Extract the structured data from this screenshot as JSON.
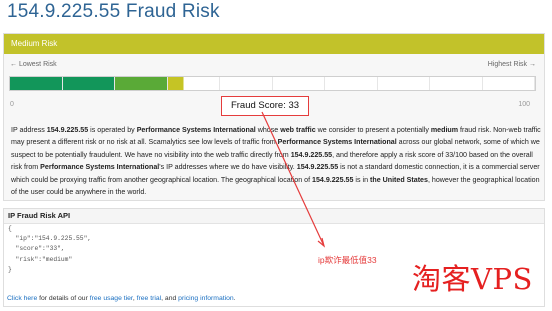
{
  "page": {
    "title": "154.9.225.55 Fraud Risk"
  },
  "risk_panel": {
    "header": "Medium Risk",
    "lowest_label": "← Lowest Risk",
    "highest_label": "Highest Risk →",
    "min": "0",
    "max": "100",
    "score_text": "Fraud Score: 33",
    "score": 33,
    "segment_colors": [
      "#12965a",
      "#12965a",
      "#5aaa37",
      "#94b52d",
      "#c5c425"
    ],
    "description": [
      {
        "t": "IP address "
      },
      {
        "t": "154.9.225.55",
        "b": true
      },
      {
        "t": " is operated by "
      },
      {
        "t": "Performance Systems International",
        "b": true
      },
      {
        "t": " whose "
      },
      {
        "t": "web traffic",
        "b": true
      },
      {
        "t": " we consider to present a potentially "
      },
      {
        "t": "medium",
        "b": true
      },
      {
        "t": " fraud risk. Non-web traffic may present a different risk or no risk at all. Scamalytics see low levels of traffic from "
      },
      {
        "t": "Performance Systems International",
        "b": true
      },
      {
        "t": " across our global network, some of which we suspect to be potentially fraudulent. We have no visibility into the web traffic directly from "
      },
      {
        "t": "154.9.225.55",
        "b": true
      },
      {
        "t": ", and therefore apply a risk score of 33/100 based on the overall risk from "
      },
      {
        "t": "Performance Systems International",
        "b": true
      },
      {
        "t": "'s IP addresses where we do have visibility. "
      },
      {
        "t": "154.9.225.55",
        "b": true
      },
      {
        "t": " is not a standard domestic connection, it is a commercial server which could be proxying traffic from another geographical location. The geographical location of "
      },
      {
        "t": "154.9.225.55",
        "b": true
      },
      {
        "t": " is in "
      },
      {
        "t": "the United States",
        "b": true
      },
      {
        "t": ", however the geographical location of the user could be anywhere in the world."
      }
    ]
  },
  "api": {
    "title": "IP Fraud Risk API",
    "code_lines": [
      "{",
      "  \"ip\":\"154.9.225.55\",",
      "  \"score\":\"33\",",
      "  \"risk\":\"medium\"",
      "}"
    ],
    "links": [
      {
        "t": "Click here",
        "link": true
      },
      {
        "t": " for details of our "
      },
      {
        "t": "free usage tier",
        "link": true
      },
      {
        "t": ", "
      },
      {
        "t": "free trial",
        "link": true
      },
      {
        "t": ", and "
      },
      {
        "t": "pricing information",
        "link": true
      },
      {
        "t": "."
      }
    ]
  },
  "annotation": {
    "text": "ip欺诈最低值33",
    "color": "#e53c3c"
  },
  "watermark": {
    "text": "淘客VPS",
    "color": "#e52020"
  }
}
